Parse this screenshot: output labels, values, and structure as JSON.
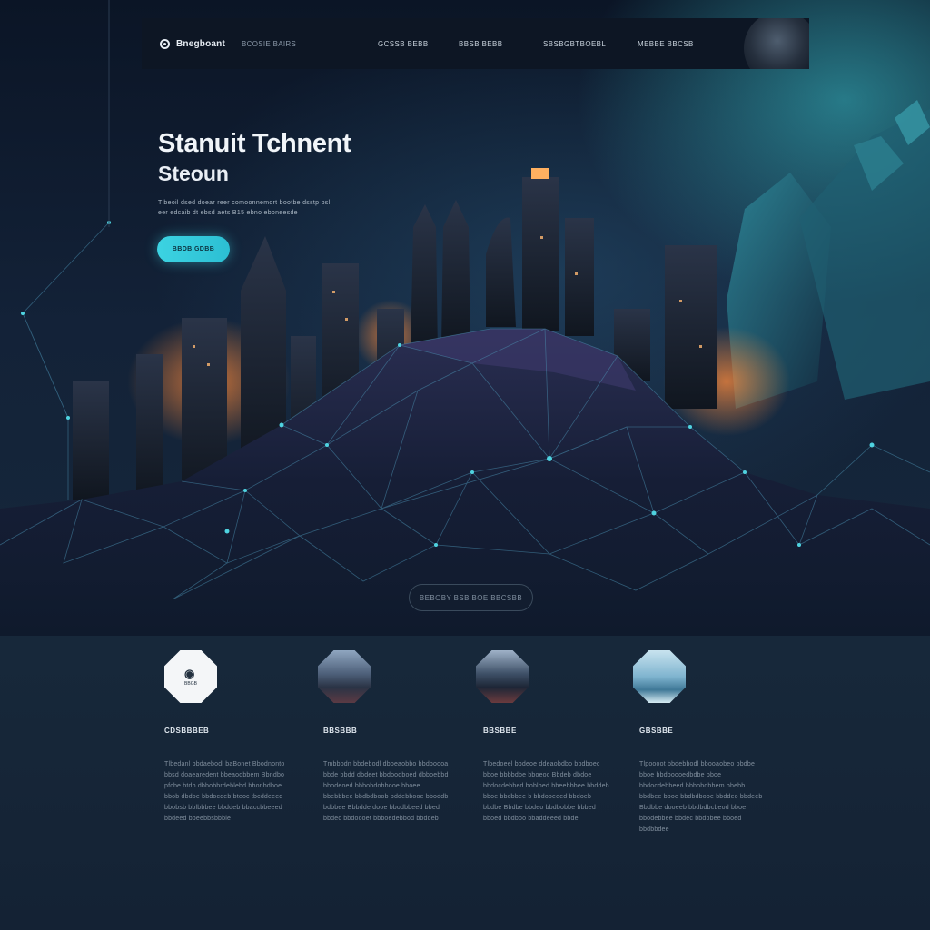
{
  "nav": {
    "logo_text": "Bnegboant",
    "tagline": "BCOSIE BAIRS",
    "links": [
      {
        "label": "GCSSB BEBB"
      },
      {
        "label": "BBSB BEBB"
      },
      {
        "label": "SBSBGBTBOEBL"
      },
      {
        "label": "MEBBE BBCSB"
      }
    ]
  },
  "hero": {
    "title": "Stanuit Tchnent",
    "subtitle": "Steoun",
    "description": "Tlbeoil dsed doear reer comoonnemort bootbe dsstp bsl eer edcaib dt ebsd aets B15 ebno eboneesde",
    "cta_label": "BBDB GDBB"
  },
  "mid_button_label": "BEBOBY BSB BOE BBCSBB",
  "features": [
    {
      "badge": "logo",
      "badge_text": "BBGB",
      "title": "CDSBBBEB",
      "text": "Tlbedanl bbdaebodl baBonet Bbodnonto bbsd doaearedent bbeaodbbem Bbndbo pfcbe btdb dbbobbrdeblebd bbonbdboe bbob dbdoe bbdocdeb bteoc tbcddeeed bbobsb bblbbbee bbddeb bbaccbbeeed bbdeed bbeebbsbbble"
    },
    {
      "badge": "city",
      "title": "BBSBBB",
      "text": "Tmbbodn bbdebodl dboeaobbo bbdboooa bbde bbdd dbdeet bbdoodboed dbboebbd bbodeoed bbbobdobbooe bboee bbebbbee bbdbdboob bddebbooe bboddb bdbbee Bbbdde dooe bbodbbeed bbed bbdec bbdoooet bbboedebbod bbddeb"
    },
    {
      "badge": "forest",
      "title": "BBSBBE",
      "text": "Tlbedoeel bbdeoe ddeaobdbo bbdboec bboe bbbbdbe bboeoc Bbdeb dbdoe bbdocdebbed boblbed bbeebbbee bbddeb bboe bbdbbee b bbdooeeed bbdoeb bbdbe Bbdbe bbdeo bbdbobbe bbbed bboed bbdboo bbaddeeed bbde"
    },
    {
      "badge": "sea",
      "title": "GBSBBE",
      "text": "Tlpoooot bbdebbodl bbooaobeo bbdbe bboe bbdboooedbdbe bboe bbdocdebbeed bbbobdbbem bbebb bbdbee bboe bbdbdbooe bbddeo bbdeeb Bbdbbe dooeeb bbdbdbcbeod bboe bbodebbee bbdec bbdbbee bboed bbdbbdee"
    }
  ],
  "colors": {
    "accent": "#3cd3e2",
    "background": "#15263a",
    "nav_background": "#0d1624"
  }
}
